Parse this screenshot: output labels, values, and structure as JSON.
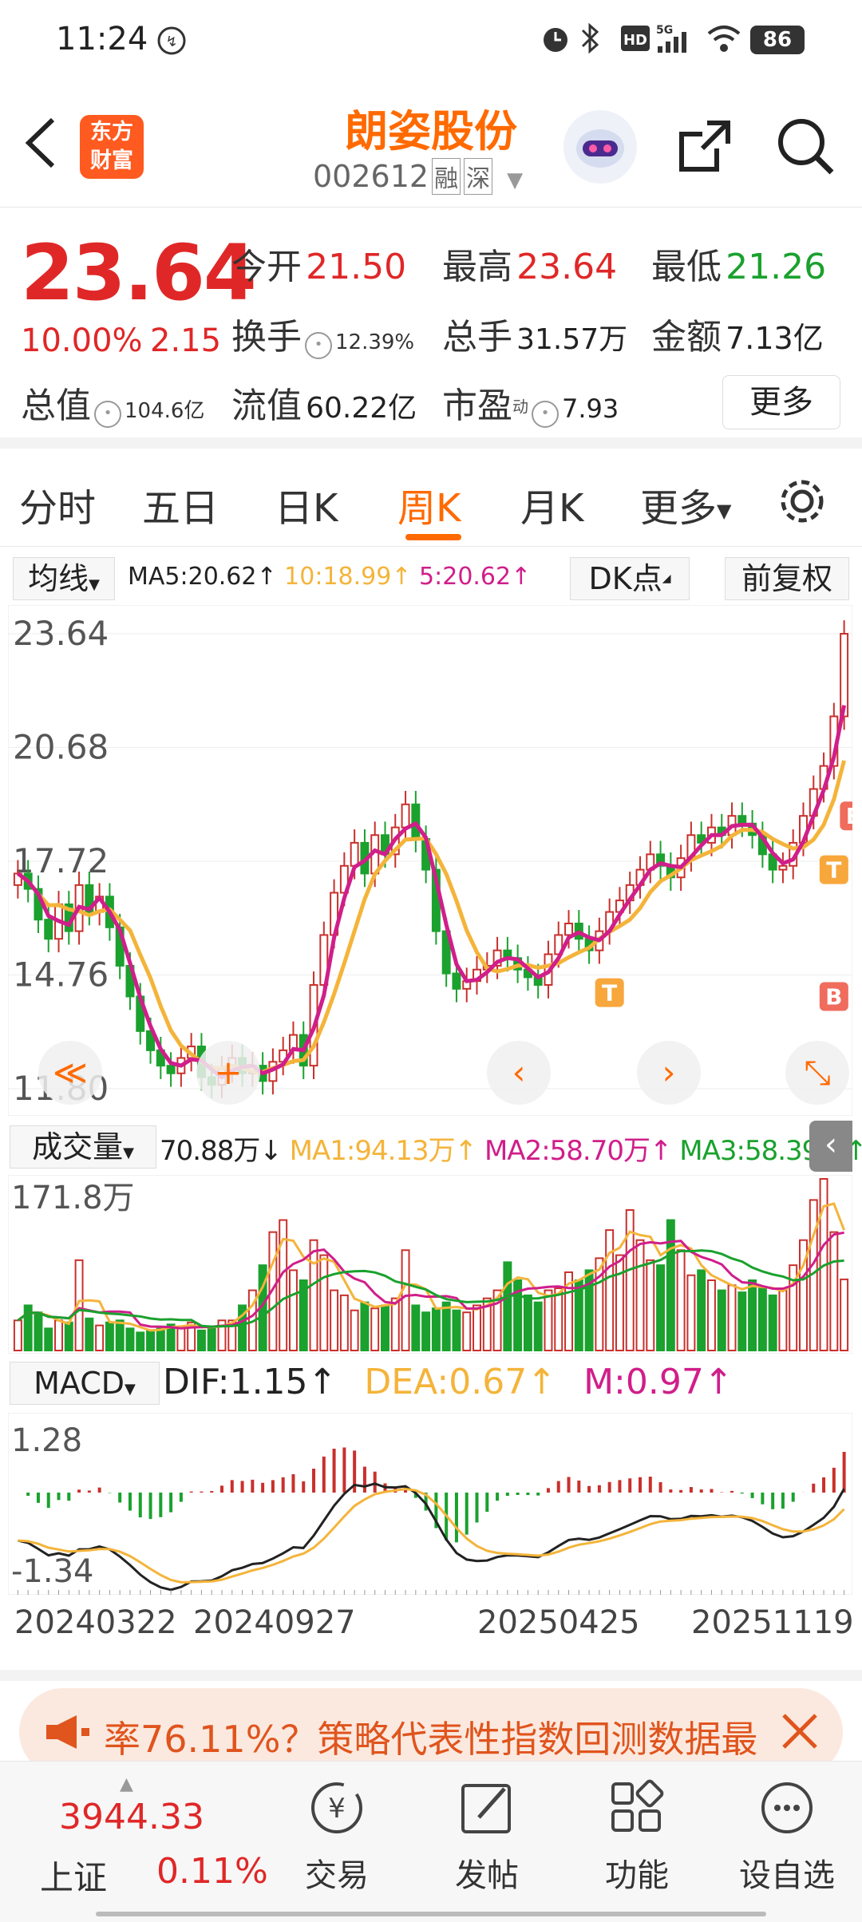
{
  "status_bar": {
    "time": "11:24",
    "battery": "86",
    "network": "5G"
  },
  "header": {
    "app_logo": "东方\n财富",
    "stock_name": "朗姿股份",
    "stock_code": "002612",
    "tag1": "融",
    "tag2": "深"
  },
  "quote": {
    "price": "23.64",
    "change_pct": "10.00%",
    "change_amt": "2.15",
    "open_label": "今开",
    "open": "21.50",
    "high_label": "最高",
    "high": "23.64",
    "low_label": "最低",
    "low": "21.26",
    "turnover_label": "换手",
    "turnover": "12.39%",
    "volume_label": "总手",
    "volume": "31.57万",
    "amount_label": "金额",
    "amount": "7.13亿",
    "mktcap_label": "总值",
    "mktcap": "104.6亿",
    "float_label": "流值",
    "float": "60.22亿",
    "pe_label": "市盈",
    "pe_sup": "动",
    "pe": "7.93",
    "more_button": "更多"
  },
  "tabs": [
    {
      "label": "分时"
    },
    {
      "label": "五日"
    },
    {
      "label": "日K"
    },
    {
      "label": "周K",
      "active": true
    },
    {
      "label": "月K"
    },
    {
      "label": "更多"
    }
  ],
  "chart_toolbar": {
    "ma_select": "均线",
    "ma5": "MA5:20.62↑",
    "ma10": "10:18.99↑",
    "ma20": "5:20.62↑",
    "dk_button": "DK点",
    "adjust_button": "前复权"
  },
  "chart_data": [
    {
      "type": "candlestick",
      "title": "周K",
      "y_tick_labels": [
        "23.64",
        "20.68",
        "17.72",
        "14.76",
        "11.80"
      ],
      "ylim": [
        11.8,
        23.64
      ],
      "series": [
        {
          "name": "MA5",
          "last": 20.62
        },
        {
          "name": "10",
          "last": 18.99
        },
        {
          "name": "5",
          "last": 20.62
        }
      ],
      "close": [
        17.4,
        17.0,
        16.2,
        15.7,
        16.6,
        15.9,
        17.1,
        16.4,
        16.8,
        16.0,
        15.0,
        14.2,
        13.3,
        12.8,
        12.4,
        12.2,
        12.6,
        12.9,
        12.1,
        11.9,
        12.3,
        12.6,
        12.2,
        12.4,
        12.0,
        12.5,
        12.8,
        13.2,
        12.4,
        14.5,
        15.8,
        16.9,
        17.6,
        18.2,
        17.4,
        18.4,
        17.9,
        18.6,
        19.2,
        18.3,
        17.5,
        15.9,
        14.8,
        14.4,
        14.6,
        14.9,
        15.0,
        15.4,
        15.2,
        14.9,
        14.7,
        14.5,
        15.3,
        15.8,
        16.1,
        15.7,
        15.4,
        15.9,
        16.4,
        16.7,
        17.1,
        17.5,
        17.9,
        17.6,
        17.3,
        17.8,
        18.4,
        18.2,
        18.6,
        18.4,
        18.9,
        18.7,
        18.4,
        17.9,
        17.5,
        17.6,
        18.2,
        18.9,
        19.6,
        20.2,
        21.49,
        23.64
      ],
      "markers": [
        {
          "label": "T",
          "type": "sell"
        },
        {
          "label": "T",
          "type": "sell"
        },
        {
          "label": "B",
          "type": "buy"
        },
        {
          "label": "B",
          "type": "buy"
        }
      ]
    },
    {
      "type": "bar",
      "title": "成交量",
      "current": "70.88万↓",
      "series_labels": [
        "MA1:94.13万↑",
        "MA2:58.70万↑",
        "MA3:58.39万↑"
      ],
      "y_tick_labels": [
        "171.8万"
      ],
      "values": [
        30,
        45,
        38,
        22,
        30,
        28,
        90,
        32,
        25,
        28,
        30,
        22,
        18,
        20,
        24,
        26,
        22,
        28,
        20,
        22,
        30,
        30,
        45,
        60,
        85,
        118,
        130,
        80,
        70,
        110,
        95,
        60,
        55,
        40,
        48,
        42,
        45,
        52,
        100,
        45,
        38,
        42,
        48,
        40,
        38,
        45,
        52,
        60,
        88,
        70,
        55,
        48,
        60,
        62,
        78,
        70,
        80,
        92,
        120,
        95,
        140,
        110,
        90,
        85,
        130,
        100,
        75,
        80,
        70,
        60,
        65,
        58,
        70,
        62,
        55,
        60,
        85,
        110,
        150,
        171,
        118,
        70.88
      ]
    },
    {
      "type": "bar",
      "title": "MACD",
      "series_labels": [
        "DIF:1.15↑",
        "DEA:0.67↑",
        "M:0.97↑"
      ],
      "y_tick_labels": [
        "1.28",
        "-1.34"
      ],
      "ylim": [
        -1.34,
        1.28
      ]
    }
  ],
  "x_tick_labels": [
    "20240322",
    "20240927",
    "20250425",
    "20251119"
  ],
  "ad_banner": {
    "text": "率76.11%？策略代表性指数回测数据最"
  },
  "bottom_bar": {
    "index_value": "3944.33",
    "index_name": "上证",
    "index_change": "0.11%",
    "items": [
      {
        "label": "交易"
      },
      {
        "label": "发帖"
      },
      {
        "label": "功能"
      },
      {
        "label": "设自选"
      }
    ]
  },
  "colors": {
    "accent": "#ff6a00",
    "up": "#e02727",
    "down": "#1aa12e",
    "ma5": "#d01e8a",
    "ma10": "#f4b43a"
  }
}
